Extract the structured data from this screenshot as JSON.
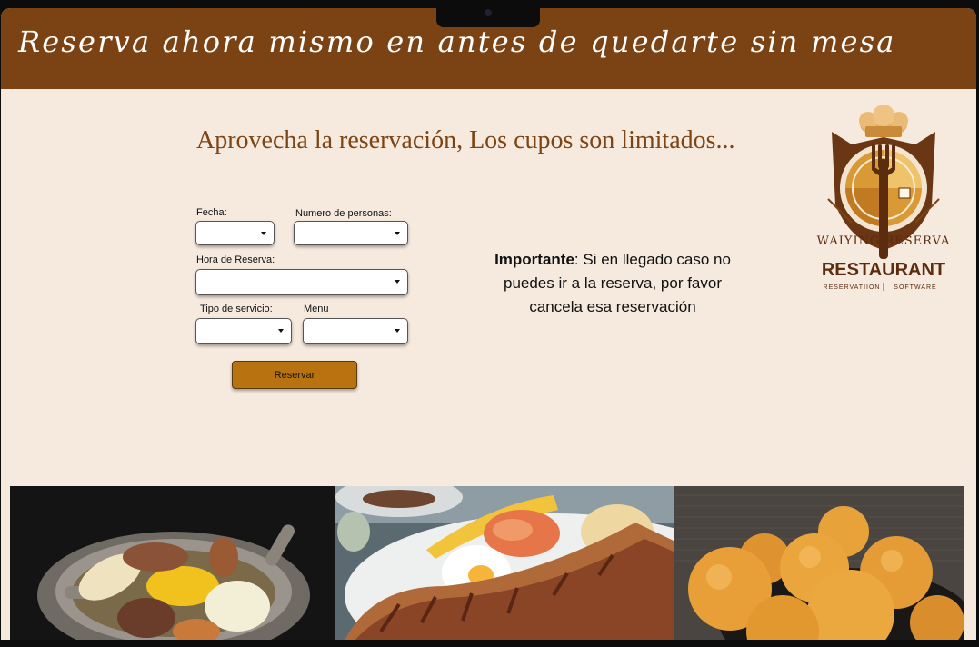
{
  "header": {
    "title": "Reserva ahora mismo en antes de quedarte sin mesa"
  },
  "subtitle": "Aprovecha la reservación, Los cupos son limitados...",
  "form": {
    "fecha_label": "Fecha:",
    "personas_label": "Numero de personas:",
    "hora_label": "Hora de Reserva:",
    "servicio_label": "Tipo de servicio:",
    "menu_label": "Menu",
    "submit_label": "Reservar"
  },
  "notice": {
    "strong": "Importante",
    "text": ": Si en llegado caso no puedes ir a la reserva, por favor cancela esa reservación"
  },
  "logo": {
    "arc_text": "WAIYING RESERVA",
    "brand": "RESTAURANT",
    "tagline_left": "RESERVATIION",
    "tagline_right": "SOFTWARE"
  },
  "colors": {
    "header_bg": "#7b4313",
    "page_bg": "#f6e9de",
    "button_bg": "#b8720f",
    "subtitle": "#7c4516"
  },
  "photos": [
    "sancocho-icon",
    "bandeja-paisa-icon",
    "bunuelos-icon"
  ]
}
